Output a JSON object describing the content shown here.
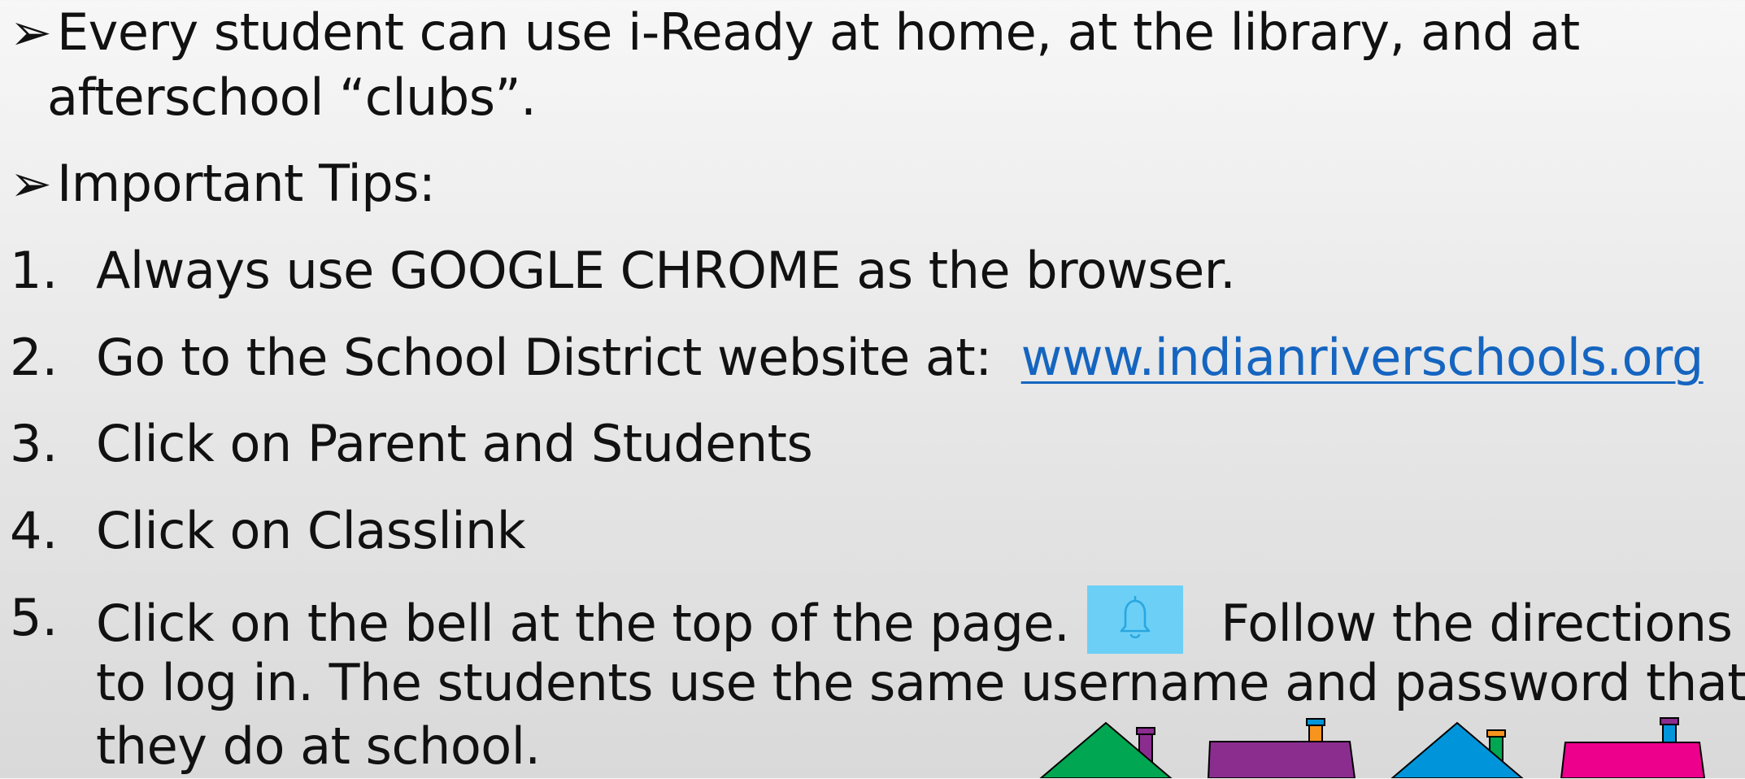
{
  "bullets": [
    {
      "marker": "➢",
      "text_line1": "Every student can use i-Ready at home, at the library, and at",
      "text_line2": "afterschool “clubs”."
    },
    {
      "marker": "➢",
      "text_line1": "Important Tips:"
    }
  ],
  "tips": [
    {
      "number": "1.",
      "text": "Always use GOOGLE CHROME as the browser."
    },
    {
      "number": "2.",
      "text": "Go to the School District website at:",
      "link": "www.indianriverschools.org"
    },
    {
      "number": "3.",
      "text": "Click on Parent and Students"
    },
    {
      "number": "4.",
      "text": "Click on Classlink"
    },
    {
      "number": "5.",
      "text_before_icon": "Click on the bell at the top of the page.",
      "icon": "bell-icon",
      "text_after_icon": "Follow the directions",
      "line2": "to log in.  The students use the same username and password that",
      "line3": "they do at school."
    }
  ],
  "colors": {
    "link": "#1565c0",
    "bell_background": "#6ccff6",
    "house_green": "#00a651",
    "house_purple": "#8b2d8f",
    "house_blue": "#0095da",
    "house_pink": "#ec008c"
  },
  "decoration": {
    "icon": "houses-illustration"
  }
}
